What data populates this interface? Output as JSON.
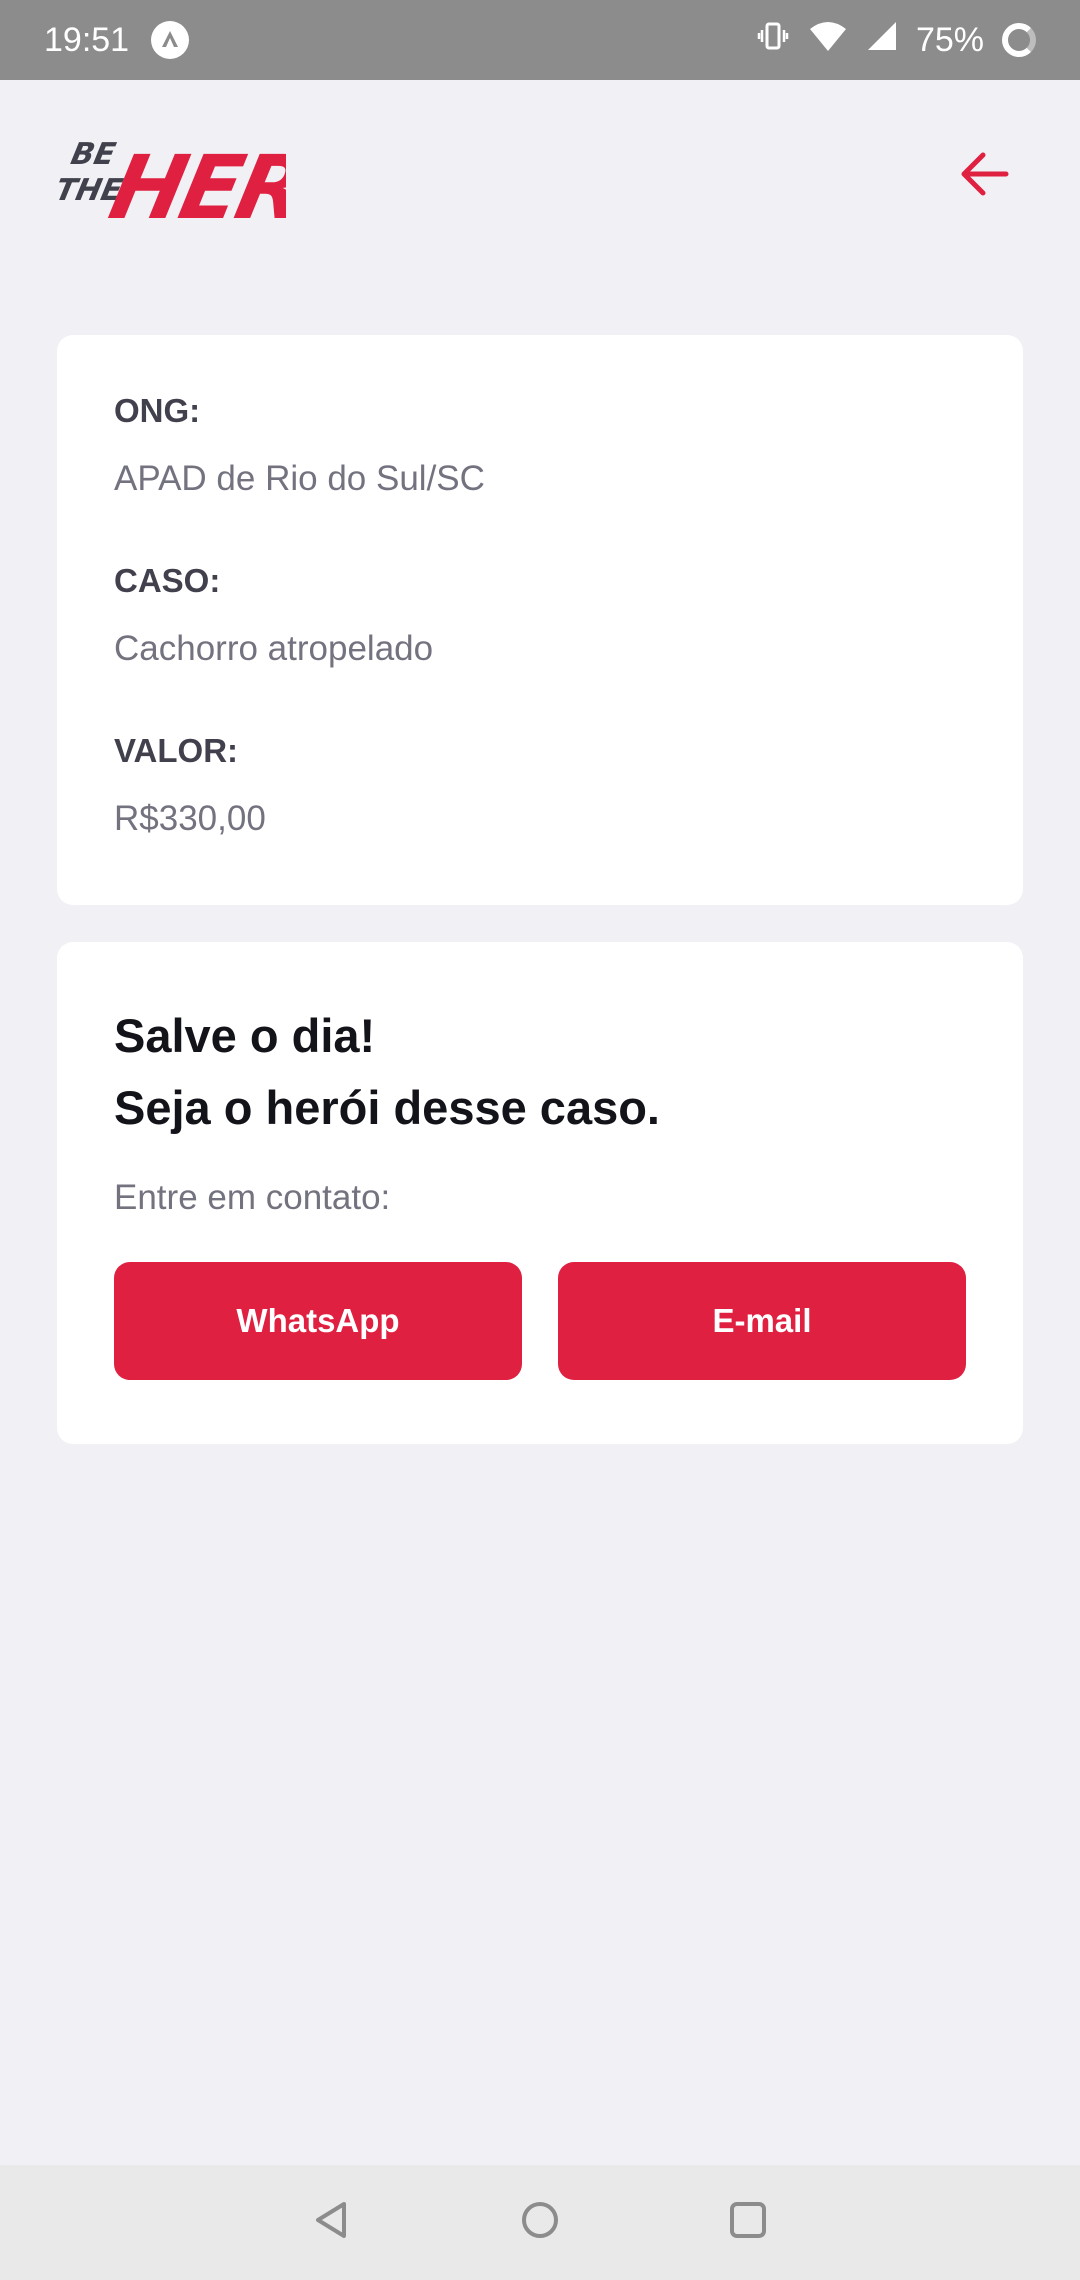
{
  "status_bar": {
    "time": "19:51",
    "battery_percent": "75%",
    "icons": [
      "app-notification-icon",
      "vibrate-icon",
      "wifi-icon",
      "signal-icon",
      "battery-icon"
    ]
  },
  "header": {
    "logo_text": [
      "BE",
      "THE",
      "HERO"
    ],
    "back_icon": "arrow-left-icon"
  },
  "incident": {
    "ong_label": "ONG:",
    "ong_value": "APAD de Rio do Sul/SC",
    "case_label": "CASO:",
    "case_value": "Cachorro atropelado",
    "value_label": "VALOR:",
    "value_value": "R$330,00"
  },
  "contact": {
    "title_line1": "Salve o dia!",
    "title_line2": "Seja o herói desse caso.",
    "description": "Entre em contato:",
    "whatsapp_label": "WhatsApp",
    "email_label": "E-mail"
  },
  "nav_bar": {
    "icons": [
      "back-triangle-icon",
      "home-circle-icon",
      "recents-square-icon"
    ]
  },
  "colors": {
    "accent": "#e02041",
    "background": "#f0f0f5",
    "card": "#ffffff",
    "label": "#41414d",
    "value": "#737380",
    "title": "#13131a",
    "status_bar": "#8c8c8c"
  }
}
